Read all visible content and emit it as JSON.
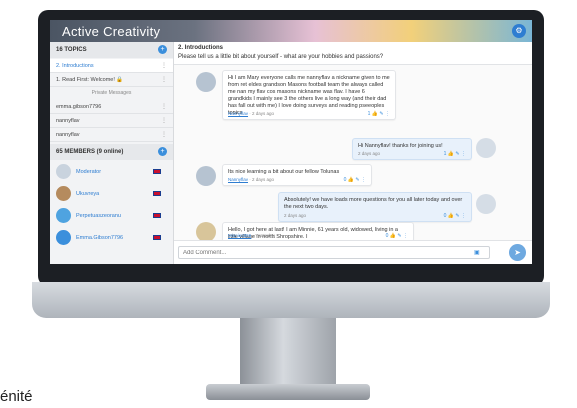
{
  "app": {
    "title": "Active Creativity"
  },
  "sidebar": {
    "topics_header": "16 TOPICS",
    "topics": [
      {
        "label": "2. Introductions",
        "active": true
      },
      {
        "label": "1. Read First: Welcome! 🔒",
        "active": false
      }
    ],
    "private_messages_label": "Private Messages",
    "private_messages": [
      {
        "label": "emma.gibson7796"
      },
      {
        "label": "nannyflav"
      },
      {
        "label": "nannyflav"
      }
    ],
    "members_header": "65 MEMBERS (9 online)",
    "members": [
      {
        "name": "Moderator"
      },
      {
        "name": "Ukuvreya"
      },
      {
        "name": "Perpetuaszeoranu"
      },
      {
        "name": "Emma.Gibson7796"
      }
    ]
  },
  "topic": {
    "title": "2. Introductions",
    "subtitle": "Please tell us a little bit about yourself - what are your hobbies and passions?"
  },
  "messages": [
    {
      "text": "Hi I am Mary everyone calls me nannyflav a nickname given to me from ret eldes grandson Masons football team the always called me nan my flav cos masons nickname was flav. I have 6 grandkids I mainly see 3 the others live a long way (and their dad has fall out with me) I love doing surveys and reading pseeoples topics",
      "author": "Nannyflav",
      "time": "2 days ago",
      "likes": "1"
    },
    {
      "text": "Hi Nannyflav! thanks for joining us!",
      "author": "",
      "time": "2 days ago",
      "likes": "1"
    },
    {
      "text": "Its nice learning a bit about our fellow Tolunas",
      "author": "Nannyflav",
      "time": "2 days ago",
      "likes": "0"
    },
    {
      "text": "Absolutely! we have loads more questions for you all later today and over the next two days.",
      "author": "",
      "time": "2 days ago",
      "likes": "0"
    },
    {
      "text": "Hello, I got here at last! I am Minnie, 61 years old, widowed, living in a little village in north Shropshire. I",
      "author": "Minnie2856",
      "time": "Yesterday",
      "likes": "0"
    }
  ],
  "composer": {
    "placeholder": "Add Comment..."
  },
  "page_fragment": "énité"
}
